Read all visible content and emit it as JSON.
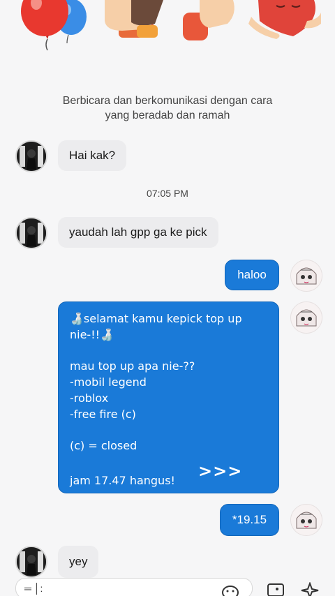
{
  "banner": {
    "icons": [
      "balloon-icon",
      "high-five-icon",
      "thumbs-up-icon",
      "heart-hug-icon"
    ]
  },
  "notice": {
    "line1": "Berbicara  dan berkomunikasi dengan cara",
    "line2": "yang beradab dan ramah"
  },
  "messages": {
    "m1": "Hai kak?",
    "time": "07:05 PM",
    "m2": "yaudah lah gpp ga ke pick",
    "m3": "haloo",
    "m4": {
      "line1": "🍶selamat kamu kepick top up",
      "line2": "nie-!!🍶",
      "line3": "mau top up apa nie-??",
      "line4": "-mobil legend",
      "line5": "-roblox",
      "line6": "-free fire (c)",
      "line7": "(c) = closed",
      "arrows": ">>>",
      "line8": "jam 17.47 hangus!"
    },
    "m5": "*19.15",
    "m6": "yey"
  },
  "input": {
    "placeholder": "═ │:"
  },
  "colors": {
    "accent": "#1a7ad8",
    "incoming": "#ececee",
    "background": "#f6f6f7"
  }
}
